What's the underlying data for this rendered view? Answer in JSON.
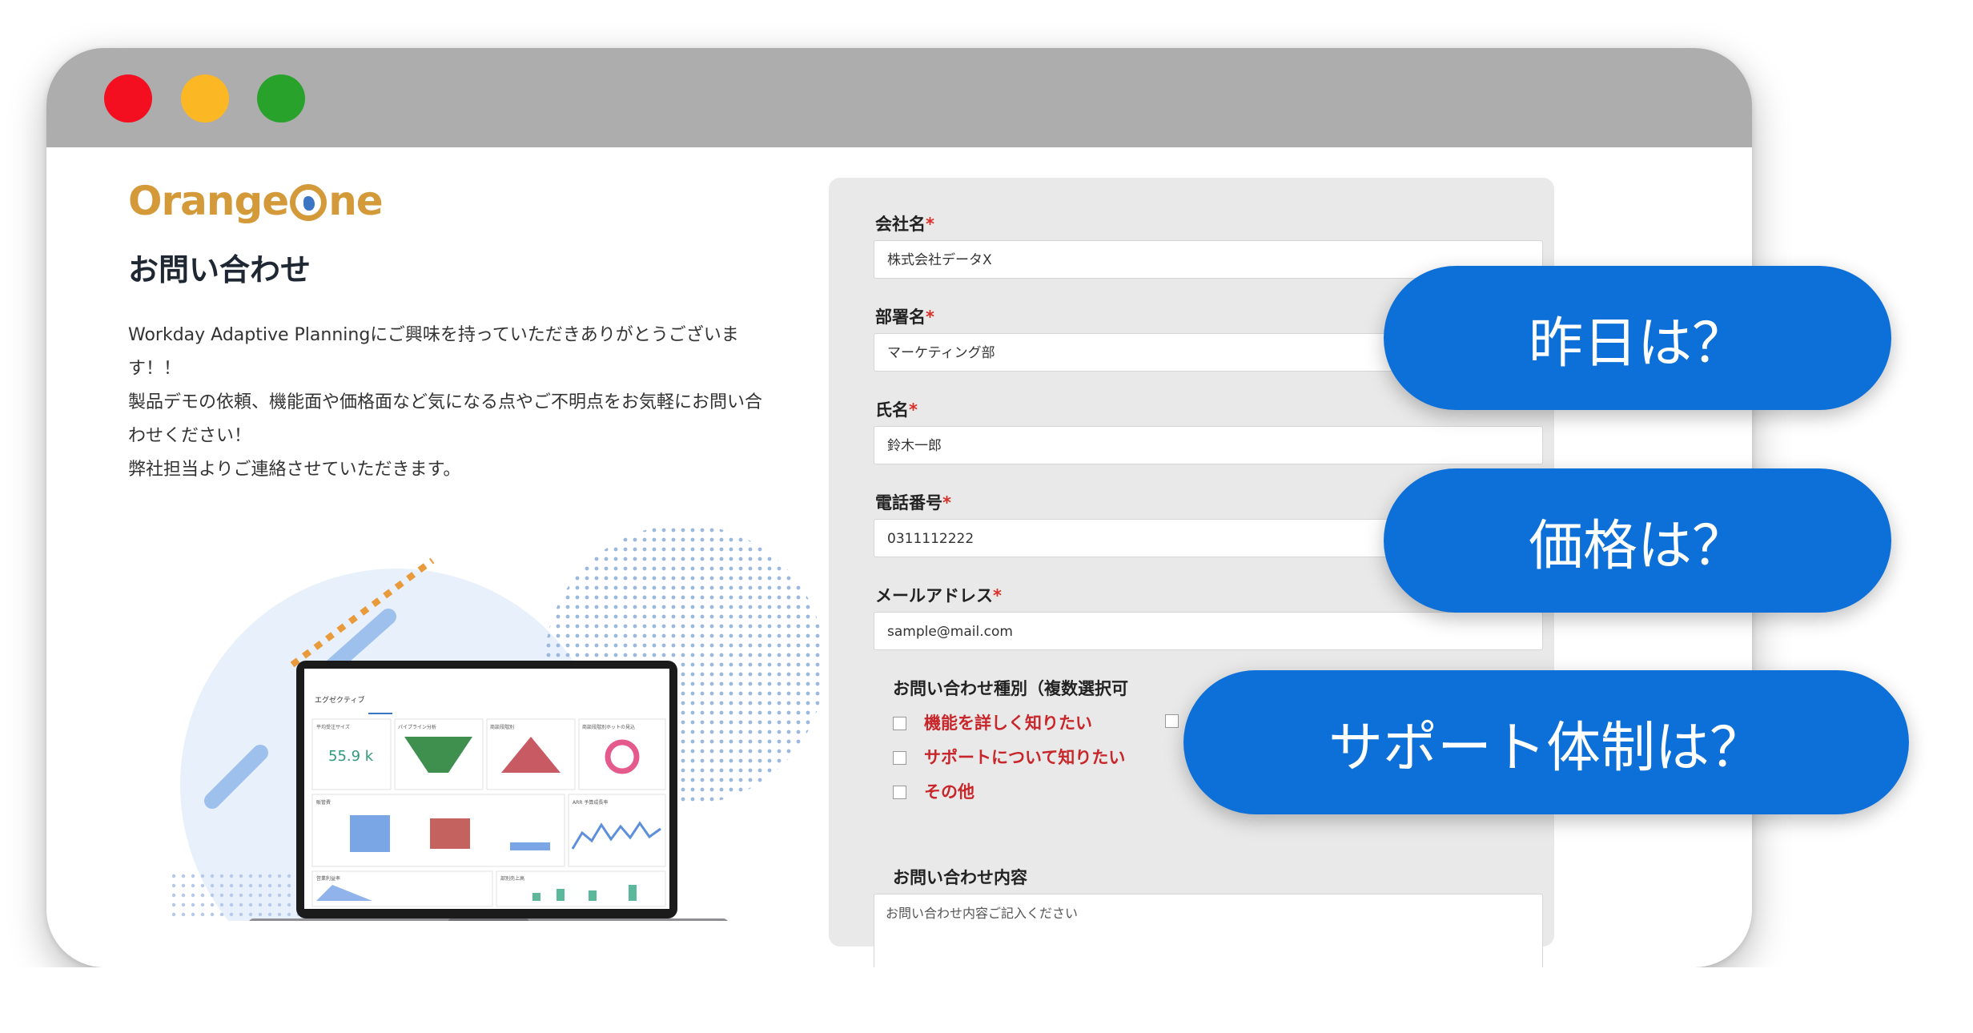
{
  "window": {
    "traffic_lights": {
      "close": "#f30f20",
      "minimize": "#fbb824",
      "maximize": "#28a22b"
    }
  },
  "brand": {
    "logo_left": "Orange",
    "logo_right": "ne"
  },
  "page": {
    "title": "お問い合わせ"
  },
  "intro": {
    "line1": "Workday Adaptive Planningにご興味を持っていただきありがとうございます！！",
    "line2": "製品デモの依頼、機能面や価格面など気になる点やご不明点をお気軽にお問い合わせください！",
    "line3": "弊社担当よりご連絡させていただきます。"
  },
  "laptop": {
    "app_title": "エグゼクティブ",
    "kpi_label": "平均受注サイズ",
    "kpi_value": "55.9 k",
    "panel_labels": [
      "パイプライン分析",
      "商談段階別",
      "商談段階別ホットの見込",
      "販管費",
      "ARR 予算成長率",
      "営業利益率",
      "部別売上高"
    ]
  },
  "form": {
    "company": {
      "label": "会社名",
      "value": "株式会社データX"
    },
    "department": {
      "label": "部署名",
      "value": "マーケティング部"
    },
    "name": {
      "label": "氏名",
      "value": "鈴木一郎"
    },
    "phone": {
      "label": "電話番号",
      "value": "0311112222"
    },
    "email": {
      "label": "メールアドレス",
      "value": "sample@mail.com"
    },
    "required_mark": "*",
    "inquiry_type_label": "お問い合わせ種別（複数選択可",
    "options": [
      "機能を詳しく知りたい",
      "サポートについて知りたい",
      "その他"
    ],
    "content_label": "お問い合わせ内容",
    "content_placeholder": "お問い合わせ内容ご記入ください"
  },
  "bubbles": [
    "昨日は？",
    "価格は？",
    "サポート体制は？"
  ],
  "colors": {
    "bubble": "#0d6fd8",
    "brand": "#d49a3a",
    "required": "#d9302a"
  }
}
